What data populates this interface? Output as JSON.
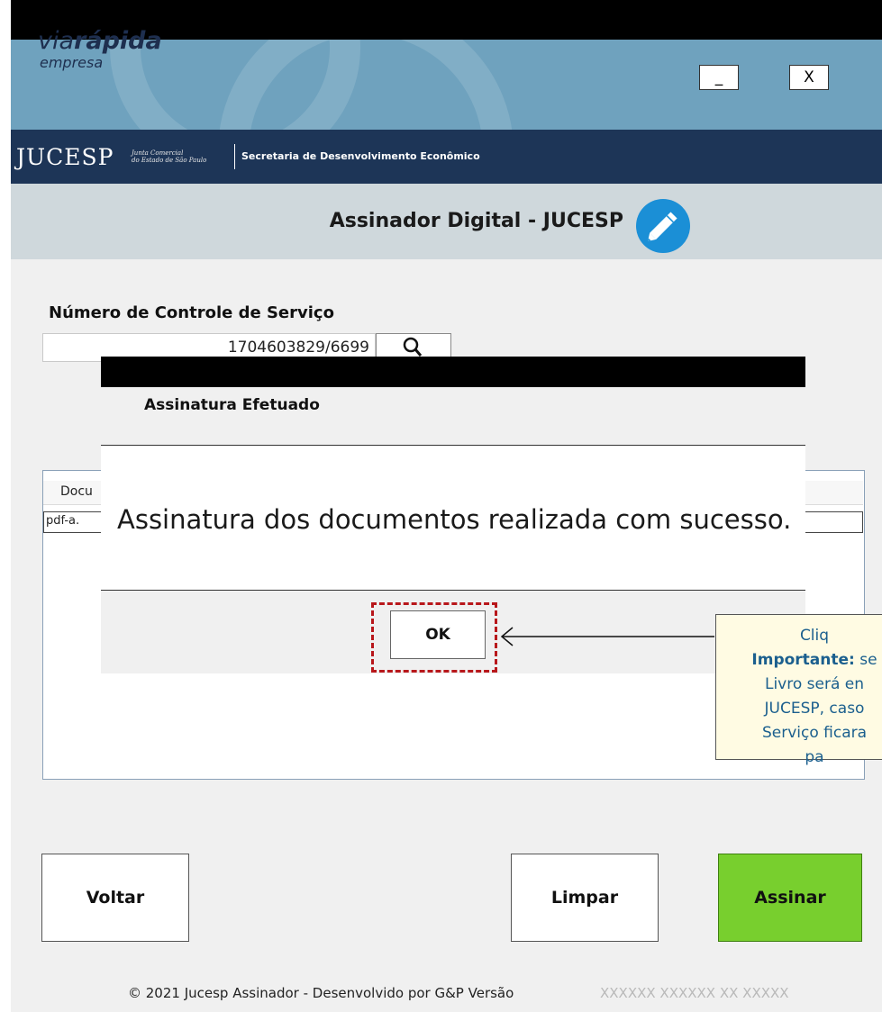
{
  "app": {
    "logo_via": "via",
    "logo_rapida": "rápida",
    "logo_empresa": "empresa",
    "minimize_label": "_",
    "close_label": "X"
  },
  "header": {
    "jucesp": "JUCESP",
    "jucesp_sub_1": "Junta Comercial",
    "jucesp_sub_2": "do Estado de São Paulo",
    "secretaria": "Secretaria de Desenvolvimento Econômico",
    "title": "Assinador Digital - JUCESP"
  },
  "form": {
    "ncs_label": "Número de Controle de Serviço",
    "ncs_value": "1704603829/6699"
  },
  "documents": {
    "header": "Docu",
    "row": "pdf-a."
  },
  "buttons": {
    "voltar": "Voltar",
    "limpar": "Limpar",
    "assinar": "Assinar"
  },
  "dialog": {
    "title": "Assinatura Efetuado",
    "message": "Assinatura dos documentos realizada com sucesso.",
    "ok": "OK"
  },
  "callout": {
    "line1": "Cliq",
    "important": "Importante:",
    "line2_rest": " se",
    "line3": "Livro será en",
    "line4": "JUCESP, caso",
    "line5": "Serviço ficara",
    "line6": "pa"
  },
  "footer": {
    "copyright": "© 2021 Jucesp Assinador - Desenvolvido por G&P Versão",
    "version": "XXXXXX XXXXXX XX XXXXX"
  },
  "colors": {
    "header_bg": "#6fa2be",
    "jucesp_bar": "#1d3557",
    "assinar_green": "#78cf2e",
    "pencil_blue": "#1b8fd6",
    "callout_text": "#1b5f8e",
    "ok_highlight": "#b8171b"
  }
}
